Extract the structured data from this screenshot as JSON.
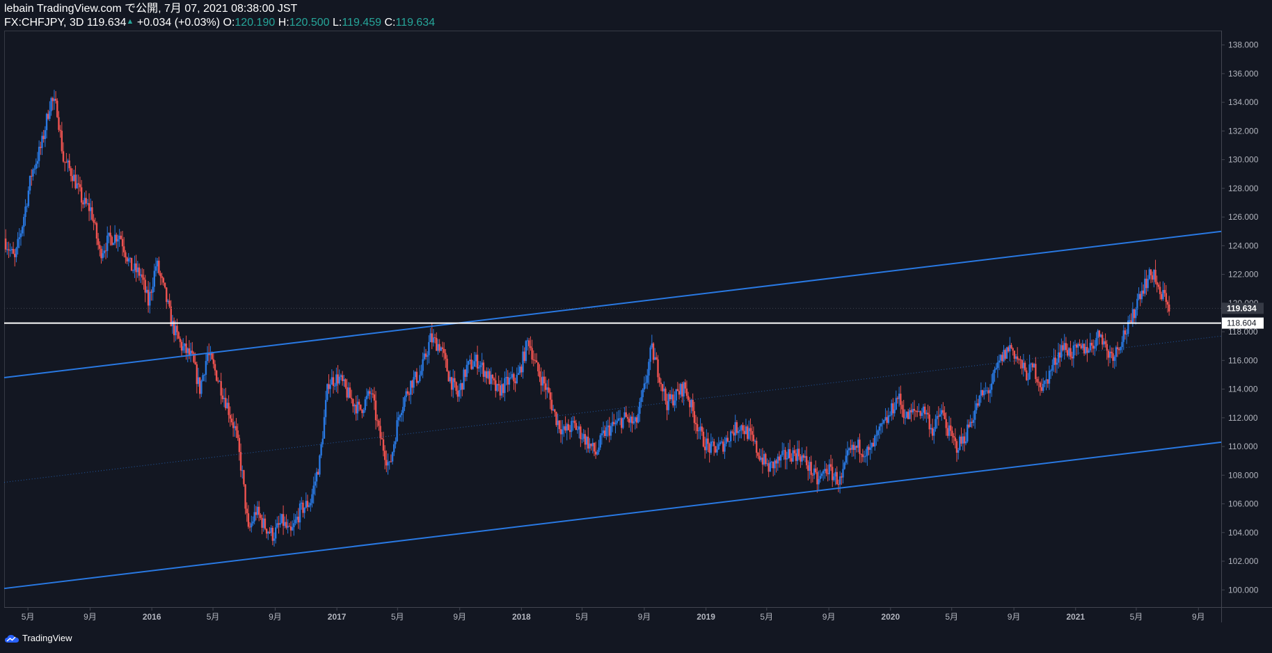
{
  "header": {
    "publish_line": "lebain TradingView.com で公開, 7月 07, 2021 08:38:00 JST",
    "symbol": "FX:CHFJPY, 3D",
    "price": "119.634",
    "change": "+0.034 (+0.03%)",
    "o_label": "O:",
    "o_value": "120.190",
    "h_label": "H:",
    "h_value": "120.500",
    "l_label": "L:",
    "l_value": "119.459",
    "c_label": "C:",
    "c_value": "119.634"
  },
  "footer": {
    "brand": "TradingView",
    "logo_icon": "tradingview-cloud-icon"
  },
  "colors": {
    "background": "#131722",
    "up": "#2979e3",
    "down": "#ef5350",
    "trendline": "#2979e3",
    "support_line": "#ffffff",
    "axis_text": "#b2b5be"
  },
  "chart_data": {
    "type": "candlestick",
    "symbol": "FX:CHFJPY",
    "timeframe": "3D",
    "x_range": [
      "2015-03-15",
      "2021-10-16"
    ],
    "ylim": [
      98.8,
      139.0
    ],
    "y_ticks": [
      "100.000",
      "102.000",
      "104.000",
      "106.000",
      "108.000",
      "110.000",
      "112.000",
      "114.000",
      "116.000",
      "118.000",
      "120.000",
      "122.000",
      "124.000",
      "126.000",
      "128.000",
      "130.000",
      "132.000",
      "134.000",
      "136.000",
      "138.000"
    ],
    "x_ticks": [
      {
        "date": "2015-05-01",
        "label": "5月"
      },
      {
        "date": "2015-09-01",
        "label": "9月"
      },
      {
        "date": "2016-01-01",
        "label": "2016"
      },
      {
        "date": "2016-05-01",
        "label": "5月"
      },
      {
        "date": "2016-09-01",
        "label": "9月"
      },
      {
        "date": "2017-01-01",
        "label": "2017"
      },
      {
        "date": "2017-05-01",
        "label": "5月"
      },
      {
        "date": "2017-09-01",
        "label": "9月"
      },
      {
        "date": "2018-01-01",
        "label": "2018"
      },
      {
        "date": "2018-05-01",
        "label": "5月"
      },
      {
        "date": "2018-09-01",
        "label": "9月"
      },
      {
        "date": "2019-01-01",
        "label": "2019"
      },
      {
        "date": "2019-05-01",
        "label": "5月"
      },
      {
        "date": "2019-09-01",
        "label": "9月"
      },
      {
        "date": "2020-01-01",
        "label": "2020"
      },
      {
        "date": "2020-05-01",
        "label": "5月"
      },
      {
        "date": "2020-09-01",
        "label": "9月"
      },
      {
        "date": "2021-01-01",
        "label": "2021"
      },
      {
        "date": "2021-05-01",
        "label": "5月"
      },
      {
        "date": "2021-09-01",
        "label": "9月"
      }
    ],
    "last_price": 119.634,
    "last_price_label": "119.634",
    "horizontal_line": {
      "value": 118.604,
      "label": "118.604"
    },
    "trendlines": [
      {
        "name": "upper",
        "points": [
          {
            "date": "2015-03-15",
            "value": 114.8
          },
          {
            "date": "2021-10-16",
            "value": 125.0
          }
        ]
      },
      {
        "name": "lower",
        "points": [
          {
            "date": "2015-03-15",
            "value": 100.1
          },
          {
            "date": "2021-10-16",
            "value": 110.3
          }
        ]
      },
      {
        "name": "middle",
        "style": "dotted",
        "points": [
          {
            "date": "2015-03-15",
            "value": 107.5
          },
          {
            "date": "2021-10-16",
            "value": 117.7
          }
        ]
      }
    ],
    "price_path": [
      [
        "2015-03-15",
        124.5
      ],
      [
        "2015-04-05",
        123.0
      ],
      [
        "2015-04-20",
        125.5
      ],
      [
        "2015-05-08",
        129.0
      ],
      [
        "2015-05-28",
        131.0
      ],
      [
        "2015-06-15",
        134.2
      ],
      [
        "2015-06-28",
        133.5
      ],
      [
        "2015-07-10",
        130.0
      ],
      [
        "2015-07-28",
        129.0
      ],
      [
        "2015-08-18",
        127.0
      ],
      [
        "2015-09-03",
        126.5
      ],
      [
        "2015-09-20",
        123.5
      ],
      [
        "2015-10-10",
        124.5
      ],
      [
        "2015-10-30",
        124.8
      ],
      [
        "2015-11-20",
        122.5
      ],
      [
        "2015-12-10",
        122.0
      ],
      [
        "2015-12-25",
        120.0
      ],
      [
        "2016-01-10",
        122.8
      ],
      [
        "2016-01-28",
        120.5
      ],
      [
        "2016-02-10",
        118.5
      ],
      [
        "2016-02-28",
        117.0
      ],
      [
        "2016-03-20",
        116.2
      ],
      [
        "2016-04-05",
        114.0
      ],
      [
        "2016-04-20",
        116.5
      ],
      [
        "2016-05-08",
        115.0
      ],
      [
        "2016-05-28",
        113.0
      ],
      [
        "2016-06-15",
        111.0
      ],
      [
        "2016-06-28",
        108.0
      ],
      [
        "2016-07-10",
        104.0
      ],
      [
        "2016-07-25",
        105.5
      ],
      [
        "2016-08-10",
        104.5
      ],
      [
        "2016-08-28",
        103.8
      ],
      [
        "2016-09-15",
        104.8
      ],
      [
        "2016-10-01",
        103.8
      ],
      [
        "2016-10-20",
        105.5
      ],
      [
        "2016-11-10",
        106.2
      ],
      [
        "2016-11-28",
        109.0
      ],
      [
        "2016-12-15",
        114.5
      ],
      [
        "2017-01-05",
        114.8
      ],
      [
        "2017-01-25",
        113.5
      ],
      [
        "2017-02-15",
        112.5
      ],
      [
        "2017-03-10",
        113.8
      ],
      [
        "2017-03-25",
        111.0
      ],
      [
        "2017-04-15",
        108.5
      ],
      [
        "2017-05-05",
        112.5
      ],
      [
        "2017-05-28",
        114.5
      ],
      [
        "2017-06-15",
        115.0
      ],
      [
        "2017-07-05",
        117.5
      ],
      [
        "2017-07-25",
        117.0
      ],
      [
        "2017-08-10",
        115.0
      ],
      [
        "2017-08-28",
        113.5
      ],
      [
        "2017-09-15",
        115.5
      ],
      [
        "2017-10-05",
        116.0
      ],
      [
        "2017-10-25",
        115.0
      ],
      [
        "2017-11-15",
        113.8
      ],
      [
        "2017-12-05",
        114.5
      ],
      [
        "2017-12-25",
        114.8
      ],
      [
        "2018-01-15",
        117.5
      ],
      [
        "2018-01-30",
        115.5
      ],
      [
        "2018-02-20",
        114.0
      ],
      [
        "2018-03-10",
        112.0
      ],
      [
        "2018-03-25",
        111.0
      ],
      [
        "2018-04-15",
        111.5
      ],
      [
        "2018-05-08",
        110.5
      ],
      [
        "2018-05-28",
        109.5
      ],
      [
        "2018-06-15",
        111.0
      ],
      [
        "2018-07-05",
        111.5
      ],
      [
        "2018-07-25",
        112.0
      ],
      [
        "2018-08-15",
        111.5
      ],
      [
        "2018-09-01",
        114.0
      ],
      [
        "2018-09-15",
        116.8
      ],
      [
        "2018-10-01",
        115.0
      ],
      [
        "2018-10-15",
        113.0
      ],
      [
        "2018-11-01",
        113.5
      ],
      [
        "2018-11-20",
        114.2
      ],
      [
        "2018-12-05",
        112.5
      ],
      [
        "2018-12-25",
        110.5
      ],
      [
        "2019-01-10",
        109.8
      ],
      [
        "2019-02-01",
        110.0
      ],
      [
        "2019-02-20",
        111.0
      ],
      [
        "2019-03-10",
        111.5
      ],
      [
        "2019-03-28",
        110.8
      ],
      [
        "2019-04-15",
        109.5
      ],
      [
        "2019-05-05",
        108.5
      ],
      [
        "2019-05-25",
        109.0
      ],
      [
        "2019-06-15",
        109.5
      ],
      [
        "2019-07-05",
        109.5
      ],
      [
        "2019-07-25",
        108.5
      ],
      [
        "2019-08-10",
        107.5
      ],
      [
        "2019-08-28",
        108.5
      ],
      [
        "2019-09-10",
        108.0
      ],
      [
        "2019-09-25",
        107.5
      ],
      [
        "2019-10-10",
        109.5
      ],
      [
        "2019-10-30",
        110.0
      ],
      [
        "2019-11-20",
        109.5
      ],
      [
        "2019-12-10",
        111.0
      ],
      [
        "2019-12-28",
        112.0
      ],
      [
        "2020-01-15",
        113.5
      ],
      [
        "2020-02-01",
        112.0
      ],
      [
        "2020-02-20",
        112.5
      ],
      [
        "2020-03-10",
        112.5
      ],
      [
        "2020-03-25",
        111.0
      ],
      [
        "2020-04-10",
        112.5
      ],
      [
        "2020-04-25",
        111.0
      ],
      [
        "2020-05-10",
        110.0
      ],
      [
        "2020-05-25",
        110.5
      ],
      [
        "2020-06-10",
        112.0
      ],
      [
        "2020-06-28",
        113.5
      ],
      [
        "2020-07-15",
        114.0
      ],
      [
        "2020-08-05",
        116.0
      ],
      [
        "2020-08-25",
        117.0
      ],
      [
        "2020-09-10",
        116.0
      ],
      [
        "2020-09-25",
        115.0
      ],
      [
        "2020-10-10",
        115.5
      ],
      [
        "2020-10-28",
        114.0
      ],
      [
        "2020-11-15",
        115.5
      ],
      [
        "2020-12-05",
        117.0
      ],
      [
        "2020-12-25",
        116.5
      ],
      [
        "2021-01-15",
        116.8
      ],
      [
        "2021-02-01",
        117.0
      ],
      [
        "2021-02-20",
        118.0
      ],
      [
        "2021-03-05",
        116.5
      ],
      [
        "2021-03-20",
        116.5
      ],
      [
        "2021-04-05",
        117.8
      ],
      [
        "2021-04-20",
        118.5
      ],
      [
        "2021-05-05",
        120.5
      ],
      [
        "2021-05-20",
        121.5
      ],
      [
        "2021-06-05",
        122.2
      ],
      [
        "2021-06-15",
        120.5
      ],
      [
        "2021-06-28",
        120.5
      ],
      [
        "2021-07-06",
        119.634
      ]
    ]
  }
}
